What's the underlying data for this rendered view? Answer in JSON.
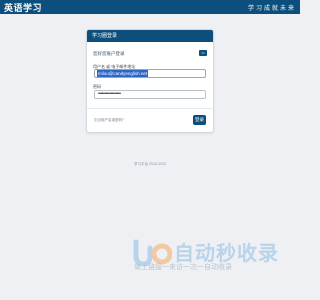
{
  "header": {
    "brand": "英语学习",
    "slogan": "学习成就未来"
  },
  "login": {
    "title": "学习圈登录",
    "user_line": "您好您账户登录",
    "badge": "▭",
    "email_label": "用户名 或 电子邮件地址",
    "email_value": "milou@candyenglish.net",
    "password_label": "密码",
    "password_value": "••••••••••••••••••",
    "forgot_link": "忘记用户名或密码？",
    "login_button": "登录"
  },
  "footer": {
    "text": "学习平台 2016-2023"
  },
  "watermark": {
    "title": "自动秒收录",
    "subtitle": "做上链接一来访一次一自动收录"
  },
  "colors": {
    "brand": "#0d4f7c",
    "selection": "#2b67c7",
    "watermark_blue": "#b8d4ea",
    "watermark_orange": "#f3c9a4"
  }
}
